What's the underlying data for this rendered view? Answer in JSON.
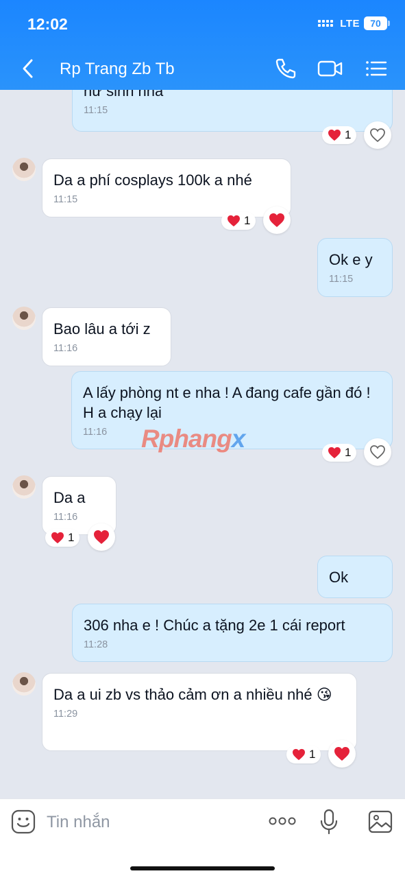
{
  "status": {
    "time": "12:02",
    "network": "LTE",
    "battery": "70"
  },
  "header": {
    "title": "Rp Trang Zb Tb"
  },
  "messages": [
    {
      "text": "nư sinh nha",
      "time": "11:15",
      "reaction_count": "1"
    },
    {
      "text": "Da a phí cosplays 100k a nhé",
      "time": "11:15",
      "reaction_count": "1"
    },
    {
      "text": "Ok e y",
      "time": "11:15"
    },
    {
      "text": "Bao lâu a tới z",
      "time": "11:16"
    },
    {
      "text": "A lấy phòng nt e nha ! A đang cafe gần đó ! H a chạy lại",
      "time": "11:16",
      "reaction_count": "1"
    },
    {
      "text": "Da a",
      "time": "11:16",
      "reaction_count": "1"
    },
    {
      "text": "Ok"
    },
    {
      "text": "306 nha e ! Chúc a tặng 2e 1 cái report",
      "time": "11:28"
    },
    {
      "text": "Da a ui zb vs thảo cảm ơn a nhiều nhé 😘",
      "time": "11:29",
      "reaction_count": "1"
    }
  ],
  "watermark": {
    "main": "Rphang",
    "x": "x"
  },
  "input": {
    "placeholder": "Tin nhắn"
  },
  "colors": {
    "header": "#2a8ff9",
    "chat_bg": "#e3e7ef",
    "outgoing_bubble": "#d7eefe",
    "heart": "#e5223a"
  }
}
